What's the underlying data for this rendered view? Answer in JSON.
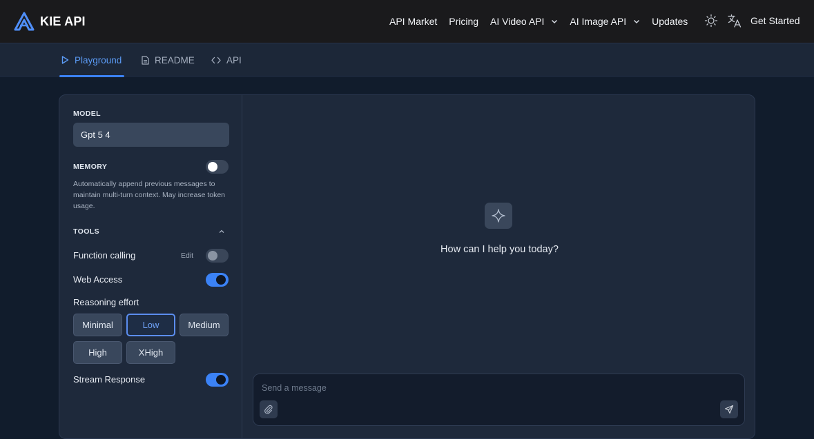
{
  "header": {
    "brand": "KIE API",
    "nav": [
      {
        "label": "API Market",
        "has_dropdown": false
      },
      {
        "label": "Pricing",
        "has_dropdown": false
      },
      {
        "label": "AI Video API",
        "has_dropdown": true
      },
      {
        "label": "AI Image API",
        "has_dropdown": true
      },
      {
        "label": "Updates",
        "has_dropdown": false
      }
    ],
    "theme_icon": "sun-icon",
    "language_icon": "translate-icon",
    "cta": "Get Started"
  },
  "tabs": [
    {
      "label": "Playground",
      "icon": "play-icon",
      "active": true
    },
    {
      "label": "README",
      "icon": "document-icon",
      "active": false
    },
    {
      "label": "API",
      "icon": "code-icon",
      "active": false
    }
  ],
  "sidebar": {
    "model_label": "MODEL",
    "model_value": "Gpt 5 4",
    "memory_label": "MEMORY",
    "memory_enabled": false,
    "memory_description": "Automatically append previous messages to maintain multi-turn context. May increase token usage.",
    "tools_label": "TOOLS",
    "function_calling_label": "Function calling",
    "function_calling_edit": "Edit",
    "function_calling_enabled": false,
    "web_access_label": "Web Access",
    "web_access_enabled": true,
    "reasoning_label": "Reasoning effort",
    "reasoning_options": [
      "Minimal",
      "Low",
      "Medium",
      "High",
      "XHigh"
    ],
    "reasoning_selected": "Low",
    "stream_label": "Stream Response",
    "stream_enabled": true
  },
  "chat": {
    "empty_icon": "sparkle-icon",
    "greeting": "How can I help you today?",
    "input_placeholder": "Send a message",
    "input_value": "",
    "attach_icon": "paperclip-icon",
    "send_icon": "send-icon"
  },
  "colors": {
    "accent": "#3b82f6",
    "header_bg": "#1a1a1c",
    "page_bg": "#111c2c",
    "panel_bg": "#1e293b"
  }
}
